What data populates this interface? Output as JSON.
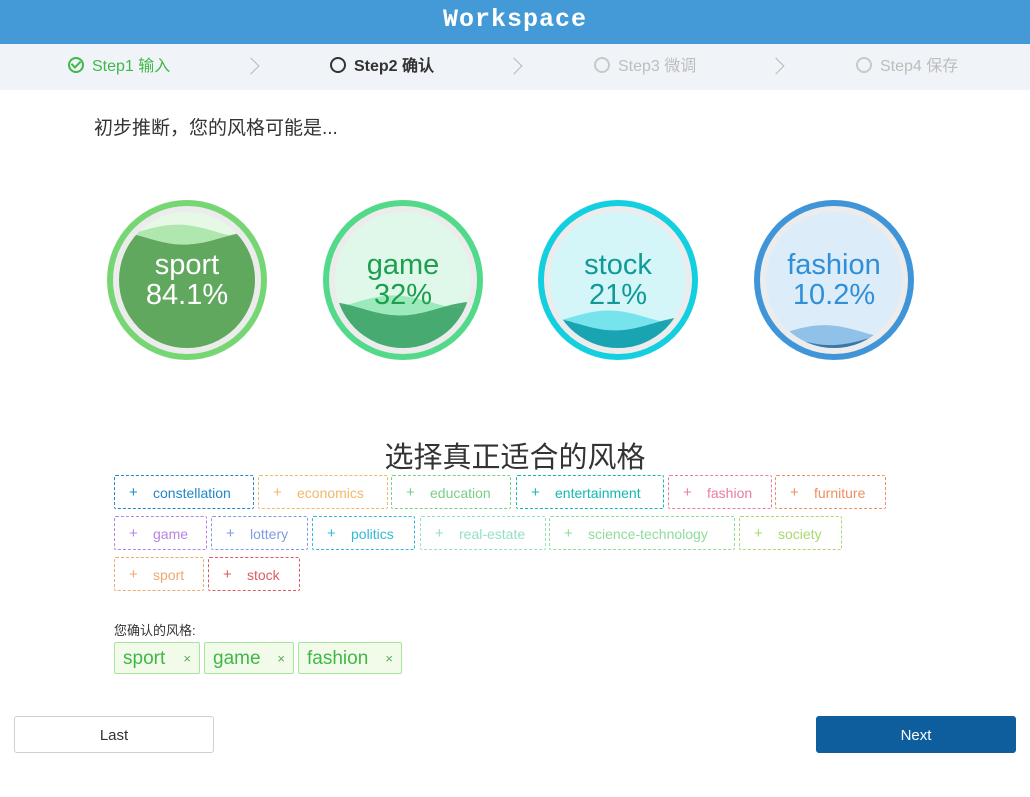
{
  "app": {
    "title": "Workspace"
  },
  "steps": [
    {
      "label": "Step1 输入",
      "state": "done"
    },
    {
      "label": "Step2 确认",
      "state": "active"
    },
    {
      "label": "Step3 微调",
      "state": "todo"
    },
    {
      "label": "Step4 保存",
      "state": "todo"
    }
  ],
  "intro": "初步推断，您的风格可能是...",
  "predictions": [
    {
      "name": "sport",
      "percent": "84.1%",
      "level": 0.841,
      "color": "#76d673",
      "text_color": "#ffffff"
    },
    {
      "name": "game",
      "percent": "32%",
      "level": 0.32,
      "color": "#52d98a",
      "text_color": "#1c9f4f"
    },
    {
      "name": "stock",
      "percent": "21%",
      "level": 0.21,
      "color": "#14cfe0",
      "text_color": "#0f9a98"
    },
    {
      "name": "fashion",
      "percent": "10.2%",
      "level": 0.102,
      "color": "#3f95d8",
      "text_color": "#2f8fd8"
    }
  ],
  "select_title": "选择真正适合的风格",
  "tags": [
    {
      "label": "constellation",
      "color": "#1e88c8"
    },
    {
      "label": "economics",
      "color": "#f2b86a"
    },
    {
      "label": "education",
      "color": "#78cf8a"
    },
    {
      "label": "entertainment",
      "color": "#13b8b4"
    },
    {
      "label": "fashion",
      "color": "#e97ea1"
    },
    {
      "label": "furniture",
      "color": "#ed8f61"
    },
    {
      "label": "game",
      "color": "#b884e0"
    },
    {
      "label": "lottery",
      "color": "#7f9be2"
    },
    {
      "label": "politics",
      "color": "#33b9d8"
    },
    {
      "label": "real-estate",
      "color": "#94e0c4"
    },
    {
      "label": "science-technology",
      "color": "#8fdc9c"
    },
    {
      "label": "society",
      "color": "#a9d96e"
    },
    {
      "label": "sport",
      "color": "#f0a770"
    },
    {
      "label": "stock",
      "color": "#e05a63"
    }
  ],
  "confirm_label": "您确认的风格:",
  "confirmed": [
    {
      "label": "sport"
    },
    {
      "label": "game"
    },
    {
      "label": "fashion"
    }
  ],
  "buttons": {
    "last": "Last",
    "next": "Next"
  },
  "icons": {
    "close": "×",
    "add": "+"
  }
}
